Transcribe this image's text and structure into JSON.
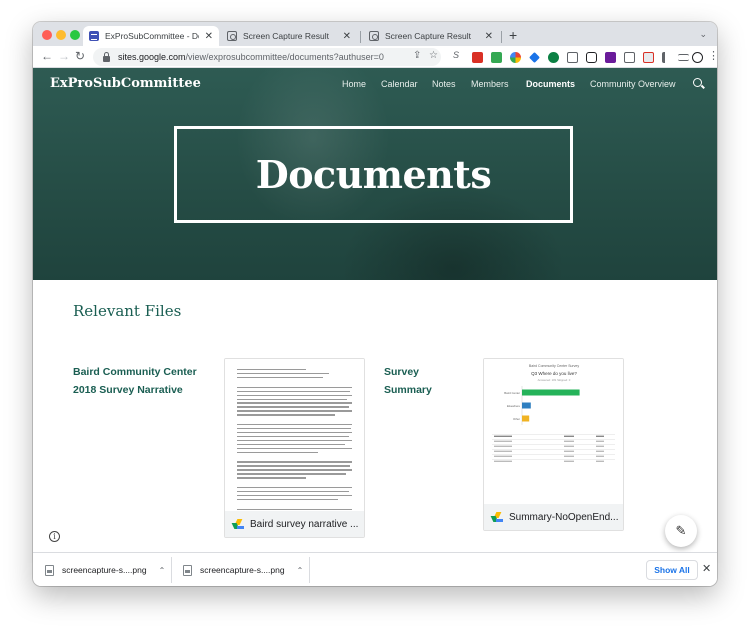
{
  "browser": {
    "tabs": [
      {
        "title": "ExProSubCommittee - Documents",
        "icon": "sites-icon"
      },
      {
        "title": "Screen Capture Result",
        "icon": "camera-icon"
      },
      {
        "title": "Screen Capture Result",
        "icon": "camera-icon"
      }
    ],
    "tab_close_glyph": "✕",
    "new_tab_glyph": "+",
    "tab_menu_glyph": "⌄",
    "nav": {
      "back": "←",
      "forward": "→",
      "reload": "↻"
    },
    "address": {
      "host": "sites.google.com",
      "path": "/view/exprosubcommittee/documents?authuser=0"
    },
    "omni_icons": {
      "share": "⇪",
      "bookmark": "☆"
    },
    "menu_glyph": "⋮"
  },
  "site": {
    "name": "ExProSubCommittee",
    "nav": [
      "Home",
      "Calendar",
      "Notes",
      "Members",
      "Documents",
      "Community Overview"
    ],
    "current": "Documents",
    "page_title": "Documents"
  },
  "section": {
    "title": "Relevant Files"
  },
  "files": [
    {
      "label_line1": "Baird Community Center",
      "label_line2": "2018 Survey Narrative",
      "caption": "Baird survey narrative ..."
    },
    {
      "label_line1": "Survey",
      "label_line2": "Summary",
      "caption": "Summary-NoOpenEnd..."
    }
  ],
  "summary_preview": {
    "header": "Baird Community Center Survey",
    "question": "Q3 Where do you live?",
    "subtitle": "Answered: 181   Skipped: 0",
    "chart_data": {
      "type": "bar",
      "orientation": "horizontal",
      "categories": [
        "Baird Center",
        "Elsewhere",
        "Other"
      ],
      "values": [
        72,
        11,
        9
      ],
      "xlim": [
        0,
        100
      ],
      "colors": [
        "#25b35a",
        "#2f7fc0",
        "#f0b323"
      ]
    }
  },
  "fab_glyph": "✎",
  "info_glyph": "i",
  "downloads": [
    {
      "name": "screencapture-s....png"
    },
    {
      "name": "screencapture-s....png"
    }
  ],
  "download_chevron": "⌃",
  "show_all": "Show All",
  "download_close": "✕"
}
